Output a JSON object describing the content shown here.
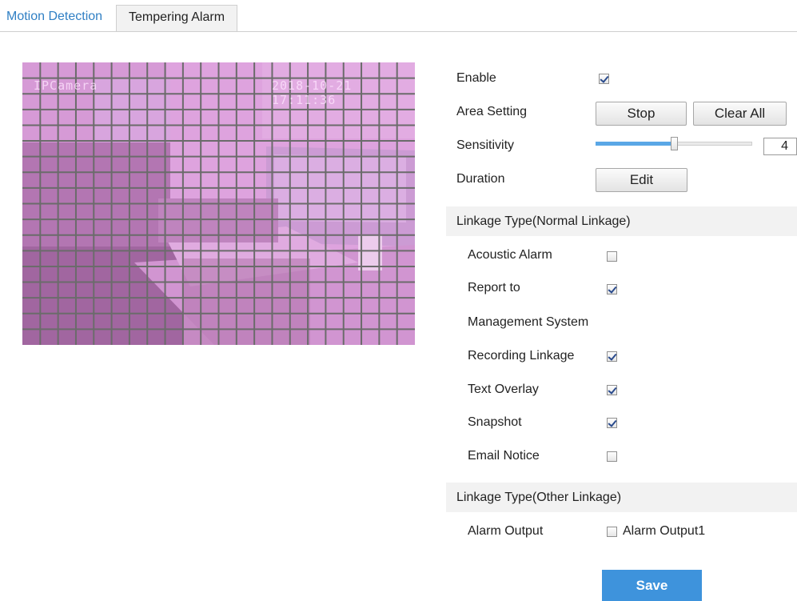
{
  "tabs": {
    "motion_detection": "Motion Detection",
    "tempering_alarm": "Tempering Alarm"
  },
  "preview": {
    "camera_name": "IPCamera",
    "timestamp": "2018-10-21 17:11:36"
  },
  "settings": {
    "enable_label": "Enable",
    "enable_checked": true,
    "area_setting_label": "Area Setting",
    "stop_label": "Stop",
    "clear_all_label": "Clear All",
    "sensitivity_label": "Sensitivity",
    "sensitivity_value": "4",
    "sensitivity_fraction": 0.5,
    "duration_label": "Duration",
    "edit_label": "Edit"
  },
  "normal_linkage": {
    "title": "Linkage Type(Normal Linkage)",
    "items": [
      {
        "label": "Acoustic Alarm",
        "checked": false
      },
      {
        "label": "Report to",
        "checked": true
      },
      {
        "label": "Management System",
        "checked": null
      },
      {
        "label": "Recording Linkage",
        "checked": true
      },
      {
        "label": "Text Overlay",
        "checked": true
      },
      {
        "label": "Snapshot",
        "checked": true
      },
      {
        "label": "Email Notice",
        "checked": false
      }
    ]
  },
  "other_linkage": {
    "title": "Linkage Type(Other Linkage)",
    "alarm_output_label": "Alarm Output",
    "alarm_output1_label": "Alarm Output1",
    "alarm_output1_checked": false
  },
  "save_label": "Save",
  "colors": {
    "accent": "#3e93dc",
    "active_tab": "#2f7fc4",
    "grid_overlay": "#d89ad8"
  }
}
